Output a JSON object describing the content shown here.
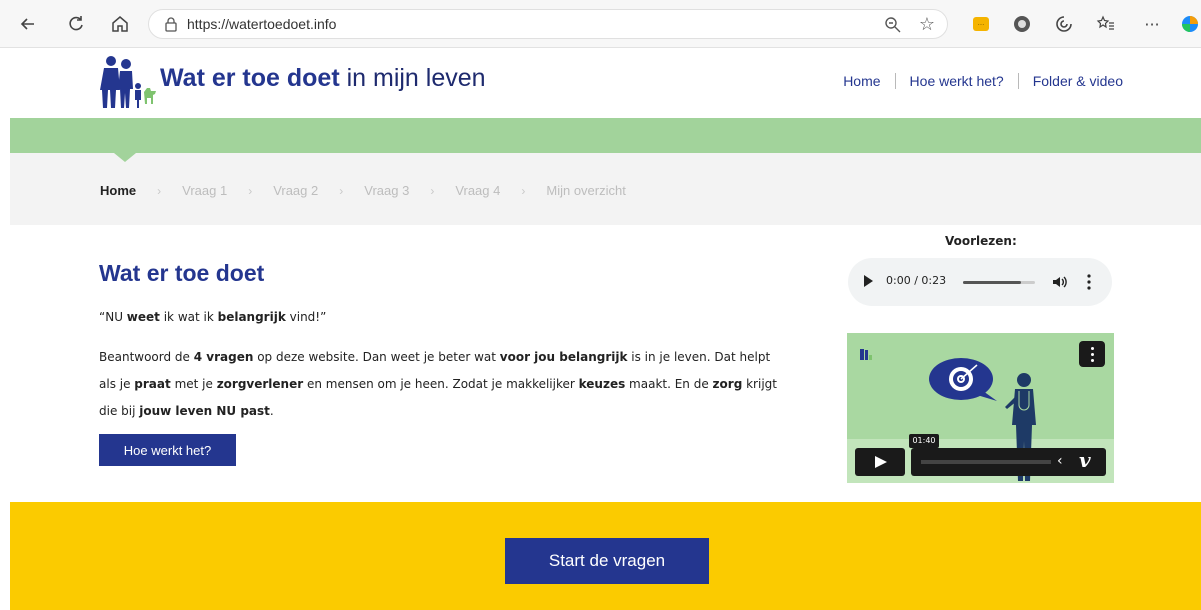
{
  "browser": {
    "url": "https://watertoedoet.info",
    "icons": [
      "back-icon",
      "refresh-icon",
      "home-icon",
      "lock-icon",
      "zoom-icon",
      "star-icon",
      "extension-icon",
      "profile-icon",
      "copilot-icon",
      "favorites-icon",
      "more-icon"
    ],
    "more": "···"
  },
  "header": {
    "brand_bold": "Wat er toe doet",
    "brand_rest": " in mijn leven",
    "nav": [
      "Home",
      "Hoe werkt het?",
      "Folder & video"
    ]
  },
  "steps": [
    "Home",
    "Vraag 1",
    "Vraag 2",
    "Vraag 3",
    "Vraag 4",
    "Mijn overzicht"
  ],
  "main": {
    "title": "Wat er toe doet",
    "quote_parts": [
      "“NU ",
      "weet",
      " ik wat ik ",
      "belangrijk",
      " vind!”"
    ],
    "body_parts": [
      "Beantwoord de ",
      "4 vragen",
      " op deze website. Dan weet je beter wat ",
      "voor jou belangrijk",
      " is in je leven. Dat helpt als je ",
      "praat",
      " met je ",
      "zorgverlener",
      " en mensen om je heen. Zodat je makkelijker ",
      "keuzes",
      " maakt. En de ",
      "zorg",
      " krijgt die bij ",
      "jouw leven NU past",
      "."
    ],
    "how_button": "Hoe werkt het?"
  },
  "audio": {
    "label": "Voorlezen:",
    "time": "0:00 / 0:23",
    "progress": 0.8
  },
  "video": {
    "timestamp": "01:40"
  },
  "cta": {
    "start_button": "Start de vragen"
  },
  "colors": {
    "brand_blue": "#24368f",
    "green": "#a2d39b",
    "yellow": "#fbcb00"
  }
}
